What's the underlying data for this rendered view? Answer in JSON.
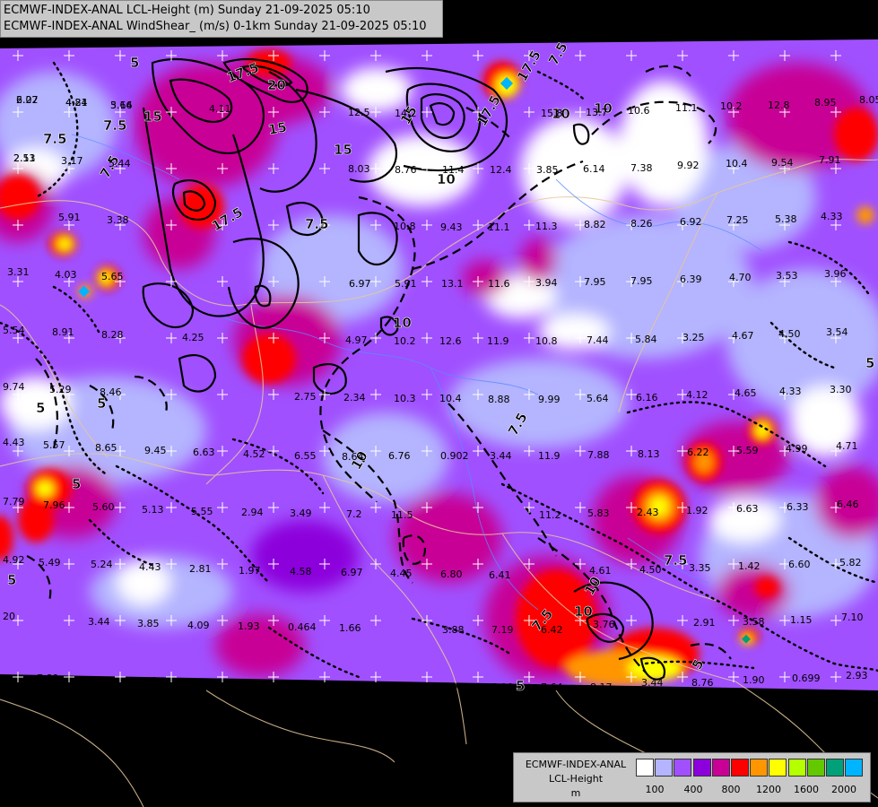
{
  "titles": {
    "line1": "ECMWF-INDEX-ANAL LCL-Height (m) Sunday 21-09-2025 05:10",
    "line2": "ECMWF-INDEX-ANAL WindShear_ (m/s) 0-1km Sunday 21-09-2025 05:10"
  },
  "legend": {
    "line1": "ECMWF-INDEX-ANAL",
    "line2": "LCL-Height",
    "line3": "m",
    "colors": [
      "#ffffff",
      "#b4b4ff",
      "#a050ff",
      "#8c00dc",
      "#c80096",
      "#ff0000",
      "#ff9600",
      "#ffff00",
      "#b4ff00",
      "#64c800",
      "#00a078",
      "#00b4ff"
    ],
    "ticks": [
      "100",
      "400",
      "800",
      "1200",
      "1600",
      "2000"
    ]
  },
  "contour_labels": [
    "17.5",
    "15",
    "20",
    "17.5",
    "15",
    "17.5",
    "15",
    "10",
    "10",
    "10",
    "15",
    "17.5",
    "10",
    "7.5",
    "7.5",
    "5",
    "5",
    "7.5",
    "10",
    "7.5",
    "5",
    "10",
    "7.5",
    "5",
    "7.5",
    "7.5",
    "5",
    "5",
    "5",
    "7.5",
    "10",
    "5"
  ],
  "station_values": [
    "2.27",
    "4.24",
    "5.66",
    "2.51",
    "3.17",
    "5.44",
    "5.91",
    "3.38",
    "3.31",
    "4.03",
    "5.65",
    "5.54",
    "8.91",
    "8.28",
    "9.74",
    "5.29",
    "8.46",
    "4.43",
    "5.57",
    "8.65",
    "9.45",
    "6.63",
    "4.52",
    "6.55",
    "8.64",
    "7.79",
    "7.96",
    "5.60",
    "5.13",
    "5.55",
    "2.94",
    "3.49",
    "7.2",
    "11.5",
    "4.92",
    "5.49",
    "5.24",
    "4.43",
    "2.81",
    "1.97",
    "4.58",
    "6.97",
    "4.45",
    "6.80",
    "6.41",
    "20",
    "3.44",
    "3.85",
    "4.09",
    "1.93",
    "0.464",
    "1.66",
    "3.88",
    "7.19",
    "6.42",
    "7.89",
    "3.16",
    "2.03",
    "3.20",
    "3.48",
    "1.94",
    "1.86",
    "3.96",
    "5.18",
    "7.64",
    "8.17",
    "6.76",
    "11.2",
    "4.11",
    "12.5",
    "14.2",
    "15.8",
    "13.7",
    "10.6",
    "11.1",
    "10.2",
    "12.8",
    "8.95",
    "8.05",
    "3.85",
    "6.14",
    "7.38",
    "9.92",
    "10.4",
    "9.54",
    "7.91",
    "8.03",
    "8.76",
    "11.4",
    "12.4",
    "10.8",
    "9.43",
    "11.1",
    "11.3",
    "8.82",
    "8.26",
    "6.92",
    "7.25",
    "5.38",
    "4.33",
    "6.97",
    "5.91",
    "13.1",
    "11.6",
    "3.94",
    "7.95",
    "7.95",
    "6.39",
    "4.70",
    "3.53",
    "3.96",
    "4.25",
    "4.97",
    "10.2",
    "12.6",
    "11.9",
    "10.8",
    "7.44",
    "5.84",
    "3.25",
    "4.67",
    "4.50",
    "3.54",
    "2.75",
    "2.34",
    "10.3",
    "10.4",
    "8.88",
    "9.99",
    "5.64",
    "6.16",
    "4.12",
    "4.65",
    "4.33",
    "3.30",
    "0.902",
    "3.44",
    "11.9",
    "7.88",
    "8.13",
    "6.22",
    "5.59",
    "4.99",
    "4.71",
    "5.83",
    "2.43",
    "1.92",
    "6.63",
    "6.33",
    "6.46",
    "4.61",
    "4.50",
    "3.35",
    "1.42",
    "6.60",
    "5.82",
    "3.76",
    "2.91",
    "3.58",
    "1.15",
    "7.10",
    "3.44",
    "1.90",
    "0.699",
    "2.93",
    "8.76",
    "6.02",
    "4.81",
    "3.14",
    "2.13"
  ]
}
